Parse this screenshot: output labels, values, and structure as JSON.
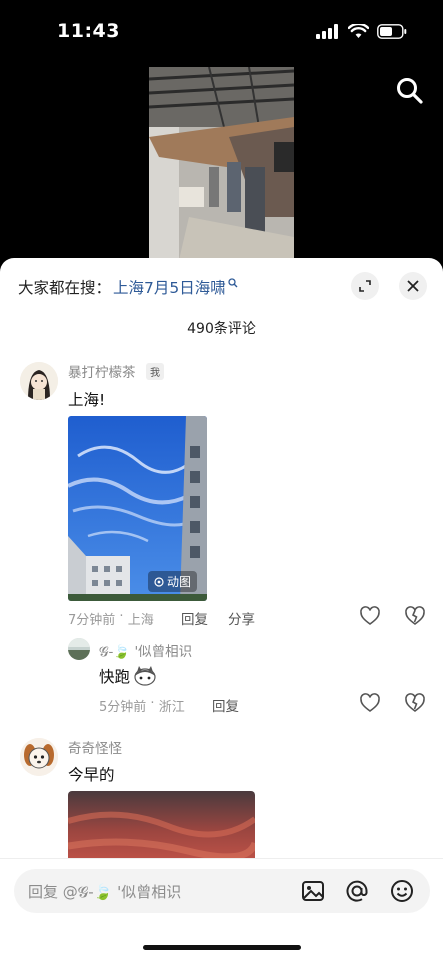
{
  "status_bar": {
    "time": "11:43"
  },
  "header": {
    "trending_prefix": "大家都在搜：",
    "trending_query": "上海7月5日海啸",
    "comment_count": "490条评论"
  },
  "comments": [
    {
      "username": "暴打柠檬茶",
      "badge": "我",
      "text": "上海!",
      "gif_label": "动图",
      "time": "7分钟前",
      "location": "上海",
      "reply_label": "回复",
      "share_label": "分享",
      "reply": {
        "username": "𝓖-🍃 '似曾相识",
        "text": "快跑",
        "time": "5分钟前",
        "location": "浙江",
        "reply_label": "回复"
      }
    },
    {
      "username": "奇奇怪怪",
      "text": "今早的"
    }
  ],
  "input": {
    "placeholder": "回复 @𝓖-🍃 '似曾相识"
  },
  "colors": {
    "link": "#2e5a97",
    "sky": "#2f6fd6",
    "sunset": "#c4453a"
  }
}
